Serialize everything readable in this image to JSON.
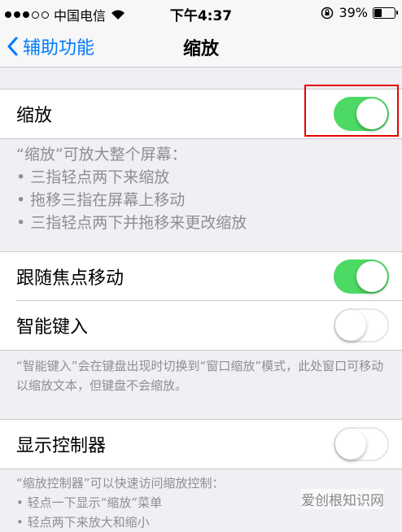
{
  "status_bar": {
    "carrier": "中国电信",
    "time": "下午4:37",
    "battery": "39%",
    "battery_level": 0.39
  },
  "nav": {
    "back_label": "辅助功能",
    "title": "缩放"
  },
  "zoom": {
    "label": "缩放",
    "enabled": true,
    "description_title": "“缩放”可放大整个屏幕：",
    "bullets": [
      "• 三指轻点两下来缩放",
      "• 拖移三指在屏幕上移动",
      "• 三指轻点两下并拖移来更改缩放"
    ]
  },
  "follow_focus": {
    "label": "跟随焦点移动",
    "enabled": true
  },
  "smart_typing": {
    "label": "智能键入",
    "enabled": false,
    "footer": "“智能键入”会在键盘出现时切换到“窗口缩放”模式，此处窗口可移动以缩放文本，但键盘不会缩放。"
  },
  "show_controller": {
    "label": "显示控制器",
    "enabled": false,
    "footer_title": "“缩放控制器”可以快速访问缩放控制：",
    "footer_bullets": [
      "• 轻点一下显示“缩放”菜单",
      "• 轻点两下来放大和缩小"
    ]
  },
  "colors": {
    "toggle_on": "#4cd964",
    "accent": "#007aff",
    "highlight": "#e60000"
  },
  "watermark": "爱创根知识网"
}
